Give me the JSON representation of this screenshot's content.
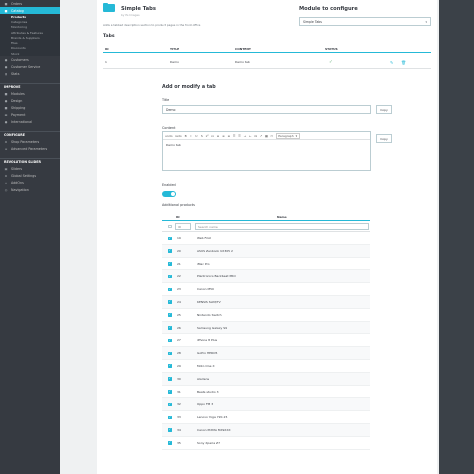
{
  "sidebar": {
    "top_items": [
      {
        "label": "Orders",
        "icon": "cart-icon"
      },
      {
        "label": "Catalog",
        "icon": "catalog-icon",
        "active": true
      }
    ],
    "catalog_sub": [
      "Products",
      "Categories",
      "Monitoring",
      "Attributes & Features",
      "Brands & Suppliers",
      "Files",
      "Discounts",
      "Stock"
    ],
    "mid_items": [
      {
        "label": "Customers",
        "icon": "user-icon"
      },
      {
        "label": "Customer Service",
        "icon": "chat-icon"
      },
      {
        "label": "Stats",
        "icon": "stats-icon"
      }
    ],
    "improve_heading": "IMPROVE",
    "improve_items": [
      {
        "label": "Modules",
        "icon": "puzzle-icon"
      },
      {
        "label": "Design",
        "icon": "brush-icon"
      },
      {
        "label": "Shipping",
        "icon": "truck-icon"
      },
      {
        "label": "Payment",
        "icon": "card-icon"
      },
      {
        "label": "International",
        "icon": "globe-icon"
      }
    ],
    "configure_heading": "CONFIGURE",
    "configure_items": [
      {
        "label": "Shop Parameters",
        "icon": "gear-icon"
      },
      {
        "label": "Advanced Parameters",
        "icon": "sliders-icon"
      }
    ],
    "revslider_heading": "REVOLUTION SLIDER",
    "revslider_items": [
      {
        "label": "Sliders",
        "icon": "slides-icon"
      },
      {
        "label": "Global Settings",
        "icon": "gear-icon"
      },
      {
        "label": "AddOns",
        "icon": "plus-icon"
      },
      {
        "label": "Navigation",
        "icon": "compass-icon"
      }
    ]
  },
  "module": {
    "title": "Simple Tabs",
    "subtitle": "by Ps Images",
    "description": "Adds a tabbed description section to product pages in the front office"
  },
  "configure": {
    "label": "Module to configure",
    "selected": "Simple Tabs"
  },
  "tabs": {
    "heading": "Tabs",
    "columns": [
      "ID",
      "TITLE",
      "CONTENT",
      "STATUS"
    ],
    "rows": [
      {
        "id": "1",
        "title": "Demo",
        "content": "Demo tab"
      }
    ]
  },
  "form": {
    "heading": "Add or modify a tab",
    "title_label": "Title",
    "title_value": "Demo",
    "copy_label": "Copy",
    "content_label": "Content",
    "content_value": "Demo tab",
    "paragraph_label": "Paragraph",
    "enabled_label": "Enabled",
    "additional_label": "Additional products",
    "id_col": "ID",
    "name_col": "Name",
    "id_filter_placeholder": "ID",
    "search_placeholder": "Search name"
  },
  "toolbar_icons": [
    "undo",
    "redo",
    "B",
    "I",
    "U",
    "S",
    "x²",
    "x₂",
    "≡",
    "≡",
    "≡",
    "☰",
    "☰",
    "→",
    "←",
    "Ω",
    "↗",
    "▦",
    "▭"
  ],
  "products": [
    {
      "id": "19",
      "name": "Web Frist"
    },
    {
      "id": "20",
      "name": "ASUS Zenbook UX305 2"
    },
    {
      "id": "21",
      "name": "iMac Pro"
    },
    {
      "id": "22",
      "name": "Plantronics Backbeat PRO"
    },
    {
      "id": "23",
      "name": "Canon M50"
    },
    {
      "id": "24",
      "name": "KENSIS SLIM/TV"
    },
    {
      "id": "25",
      "name": "Nintendo Switch"
    },
    {
      "id": "26",
      "name": "Samsung Galaxy S9"
    },
    {
      "id": "27",
      "name": "iPhone 8 Plus"
    },
    {
      "id": "28",
      "name": "GoPro HERO5"
    },
    {
      "id": "29",
      "name": "Moto One X"
    },
    {
      "id": "30",
      "name": "Alarlens"
    },
    {
      "id": "31",
      "name": "Beats studio 3"
    },
    {
      "id": "32",
      "name": "Oppo FM 3"
    },
    {
      "id": "33",
      "name": "Lenovo Yoga 720-15"
    },
    {
      "id": "34",
      "name": "Canon PIXMA MX9XXX"
    },
    {
      "id": "35",
      "name": "Sony Xperia Z7"
    }
  ],
  "colors": {
    "accent": "#25b9d7",
    "sidebar": "#363a41",
    "success": "#70b580"
  }
}
